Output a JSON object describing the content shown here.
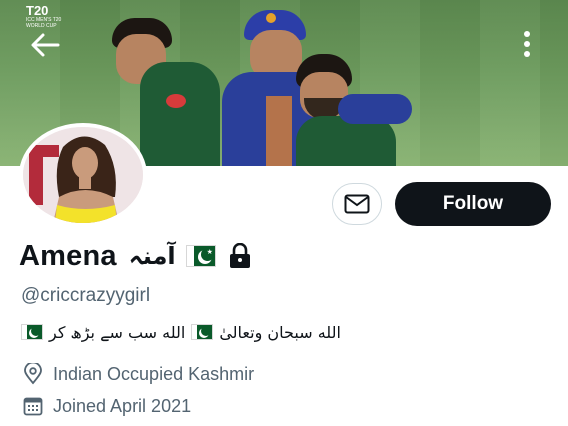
{
  "header": {
    "event_logo_text": "T20",
    "event_logo_subtext": "ICC MEN'S T20 WORLD CUP"
  },
  "profile": {
    "display_name": "Amena",
    "urdu_name": "آمنہ",
    "handle": "@criccrazyygirl",
    "bio_parts": [
      "الله سبحان وتعالیٰ",
      "الله سب سے بڑھ کر"
    ],
    "location": "Indian Occupied Kashmir",
    "joined": "Joined April 2021"
  },
  "actions": {
    "follow_label": "Follow"
  },
  "icons": {
    "back": "back-arrow-icon",
    "more": "more-vertical-icon",
    "message": "envelope-icon",
    "lock": "lock-icon",
    "location": "location-pin-icon",
    "calendar": "calendar-icon",
    "flag": "pakistan-flag-icon"
  },
  "colors": {
    "follow_bg": "#0f1419",
    "muted_text": "#536471",
    "flag_green": "#0a5a2a"
  }
}
